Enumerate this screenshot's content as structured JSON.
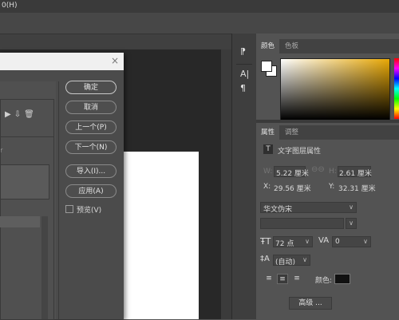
{
  "menubar": {
    "fragment": "0(H)"
  },
  "dialog": {
    "close_glyph": "×",
    "buttons": {
      "ok": "确定",
      "cancel": "取消",
      "prev": "上一个(P)",
      "next": "下一个(N)",
      "import": "导入(I)...",
      "apply": "应用(A)"
    },
    "preview_label": "预览(V)",
    "row_marker": "r"
  },
  "toolstrip": {
    "icons": [
      "brush-settings-icon",
      "character-panel-icon",
      "paragraph-panel-icon"
    ]
  },
  "color_panel": {
    "tabs": [
      "颜色",
      "色板"
    ],
    "active_tab": "颜色",
    "base_color": "#e8a806"
  },
  "properties_panel": {
    "tabs": [
      "属性",
      "调整"
    ],
    "active_tab": "属性",
    "type_badge": "T",
    "layer_kind": "文字图层属性",
    "w_label": "W:",
    "w_value": "5.22 厘米",
    "h_label": "H:",
    "h_value": "2.61 厘米",
    "x_label": "X:",
    "x_value": "29.56 厘米",
    "y_label": "Y:",
    "y_value": "32.31 厘米",
    "font_family": "华文伪宋",
    "font_size": "72 点",
    "tracking": "0",
    "leading": "(自动)",
    "color_label": "颜色:",
    "color_value": "#111111",
    "advanced_button": "高级 ..."
  }
}
